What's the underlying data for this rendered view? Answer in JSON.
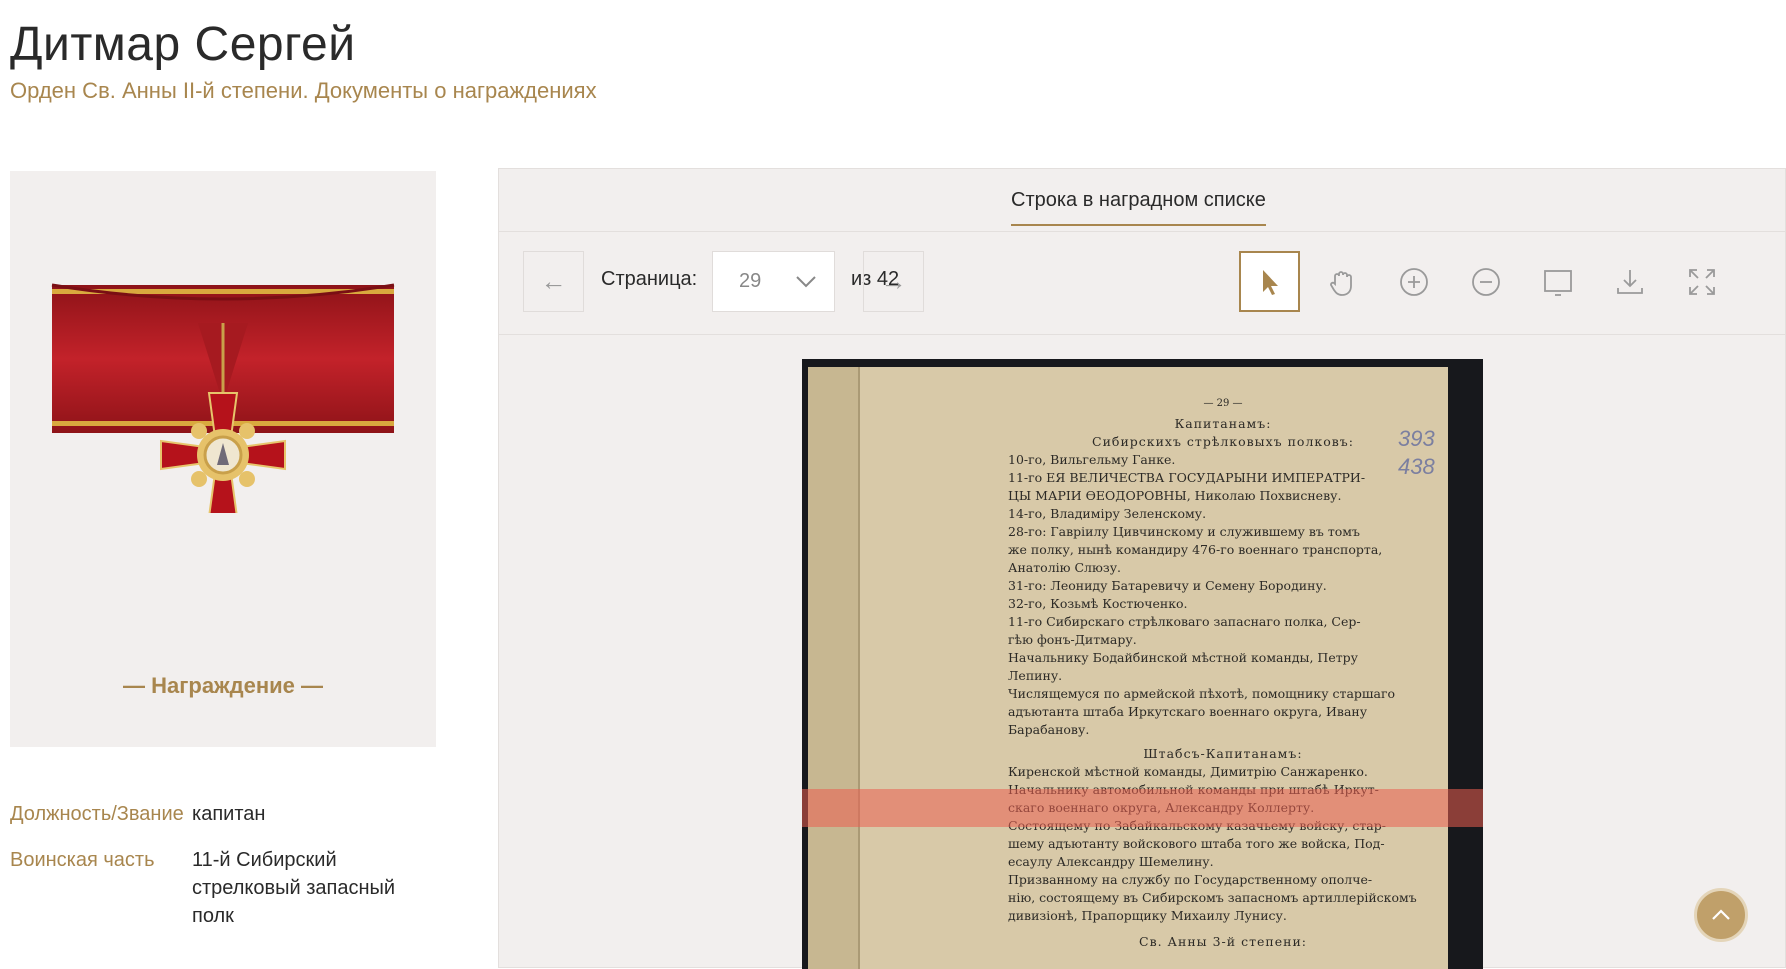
{
  "page": {
    "title": "Дитмар Сергей",
    "subtitle": "Орден Св. Анны II-й степени. Документы о награждениях"
  },
  "award": {
    "caption": "— Награждение —"
  },
  "info": [
    {
      "label": "Должность/Звание",
      "value": "капитан"
    },
    {
      "label": "Воинская часть",
      "value": "11-й Сибирский стрелковый запасный полк"
    }
  ],
  "viewer": {
    "tab_label": "Строка в наградном списке",
    "page_label": "Страница:",
    "page_value": "29",
    "page_total": "из 42",
    "prev_icon": "arrow-left-icon",
    "next_icon": "arrow-right-icon",
    "tools": [
      "pointer-icon",
      "hand-icon",
      "zoom-in-icon",
      "zoom-out-icon",
      "fit-page-icon",
      "download-icon",
      "fullscreen-icon"
    ]
  },
  "document": {
    "page_number": "— 29 —",
    "handwritten": [
      "393",
      "438"
    ],
    "lines": [
      "Капитанамъ:",
      "Сибирскихъ стрѣлковыхъ полковъ:",
      "10-го, Вильгельму Ганке.",
      "11-го ЕЯ ВЕЛИЧЕСТВА ГОСУДАРЫНИ ИМПЕРАТРИ-",
      "ЦЫ МАРІИ ѲЕОДОРОВНЫ, Николаю Похвисневу.",
      "14-го, Владиміру Зеленскому.",
      "28-го: Гавріилу Цивчинскому и служившему въ томъ",
      "же полку, нынѣ командиру 476-го военнаго транспорта,",
      "Анатолію Слюзу.",
      "31-го: Леониду Батаревичу и Семену Бородину.",
      "32-го, Козьмѣ Костюченко.",
      "11-го Сибирскаго стрѣлковаго запаснаго полка, Сер-",
      "гѣю фонъ-Дитмару.",
      "Начальнику Бодайбинской мѣстной команды, Петру",
      "Лепину.",
      "Числящемуся по армейской пѣхотѣ, помощнику старшаго",
      "адъютанта штаба Иркутскаго военнаго округа, Ивану",
      "Барабанову.",
      "Штабсъ-Капитанамъ:",
      "Киренской мѣстной команды, Димитрію Санжаренко.",
      "Начальнику автомобильной команды при штабѣ Иркут-",
      "скаго военнаго округа, Александру Коллерту.",
      "Состоящему по Забайкальскому казачьему войску, стар-",
      "шему адъютанту войскового штаба того же войска, Под-",
      "есаулу Александру Шемелину.",
      "Призванному на службу по Государственному ополче-",
      "нію, состоящему въ Сибирскомъ запасномъ артиллерійскомъ",
      "дивизіонѣ, Прапорщику Михаилу Лунису.",
      "Св. Анны 3-й степени:"
    ]
  }
}
